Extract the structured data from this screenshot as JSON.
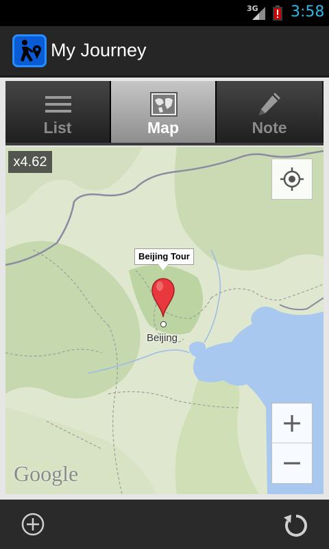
{
  "status_bar": {
    "network": "3G",
    "time": "3:58",
    "battery_color": "#cc0000",
    "clock_color": "#33b5e5"
  },
  "action_bar": {
    "title": "My Journey",
    "icon": "hiker-pin-icon"
  },
  "tabs": [
    {
      "label": "List",
      "icon": "list-icon",
      "active": false
    },
    {
      "label": "Map",
      "icon": "map-icon",
      "active": true
    },
    {
      "label": "Note",
      "icon": "pencil-icon",
      "active": false
    }
  ],
  "map": {
    "zoom_level": "x4.62",
    "marker_title": "Beijing Tour",
    "city_label": "Beijing",
    "attribution": "Google",
    "zoom_in_label": "+",
    "zoom_out_label": "−",
    "locate_icon": "my-location-icon",
    "marker_color": "#e8383d",
    "water_color": "#a8c8f0",
    "land_color": "#dfe8cf"
  },
  "bottom_bar": {
    "add_icon": "add-circle-icon",
    "refresh_icon": "refresh-icon"
  }
}
